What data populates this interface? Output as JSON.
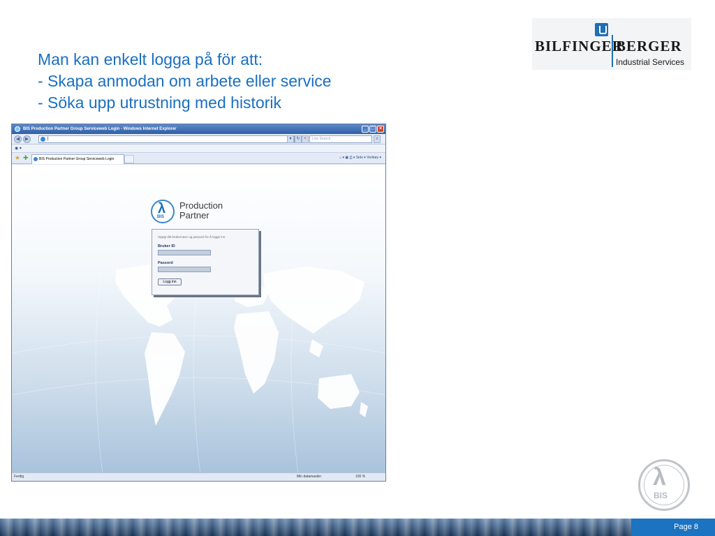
{
  "slide": {
    "heading_lines": [
      "Man kan enkelt logga på för att:",
      "- Skapa anmodan om arbete eller service",
      "- Söka upp utrustning med historik"
    ],
    "page_label": "Page 8"
  },
  "logo": {
    "left_word": "BILFINGER",
    "right_word": "BERGER",
    "subtitle": "Industrial Services",
    "brand_color": "#1e6fb5"
  },
  "browser": {
    "window_title": "BIS Production Partner Group Serviceweb Login - Windows Internet Explorer",
    "address_value": "|",
    "search_placeholder": "Live Search",
    "tab_label": "BIS Production Partner Group Serviceweb Login",
    "tools_text": "Side ▾  Verktøy ▾",
    "status_text": "Ferdig",
    "status_zone": "Min datamaskin",
    "status_zoom": "100 %"
  },
  "login_page": {
    "logo_text": "BIS",
    "product_name_line1": "Production",
    "product_name_line2": "Partner",
    "hint": "Oppgi ditt brukernavn og passord for å logge inn.",
    "user_label": "Bruker ID",
    "password_label": "Passord",
    "login_button": "Logg inn"
  },
  "watermark": {
    "text": "BIS"
  }
}
